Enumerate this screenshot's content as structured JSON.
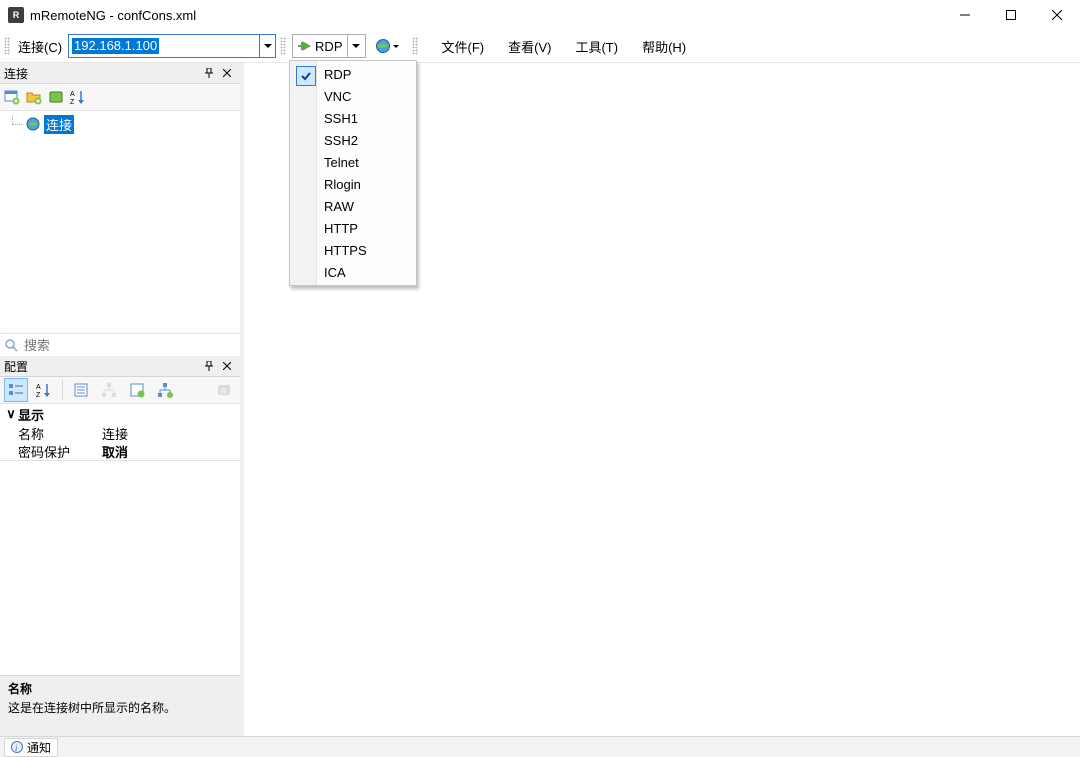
{
  "window": {
    "title": "mRemoteNG - confCons.xml",
    "icon_text": "R"
  },
  "toolbar": {
    "connect_label": "连接(C)",
    "address_value": "192.168.1.100",
    "protocol_value": "RDP",
    "menu": [
      "文件(F)",
      "查看(V)",
      "工具(T)",
      "帮助(H)"
    ]
  },
  "protocol_dropdown": {
    "options": [
      "RDP",
      "VNC",
      "SSH1",
      "SSH2",
      "Telnet",
      "Rlogin",
      "RAW",
      "HTTP",
      "HTTPS",
      "ICA"
    ],
    "selected_index": 0
  },
  "connections_panel": {
    "title": "连接",
    "root_node": "连接",
    "search_placeholder": "搜索"
  },
  "config_panel": {
    "title": "配置",
    "category": "显示",
    "rows": [
      {
        "key": "名称",
        "value": "连接",
        "bold": false
      },
      {
        "key": "密码保护",
        "value": "取消",
        "bold": true
      }
    ],
    "desc_title": "名称",
    "desc_body": "这是在连接树中所显示的名称。"
  },
  "statusbar": {
    "notify": "通知"
  }
}
